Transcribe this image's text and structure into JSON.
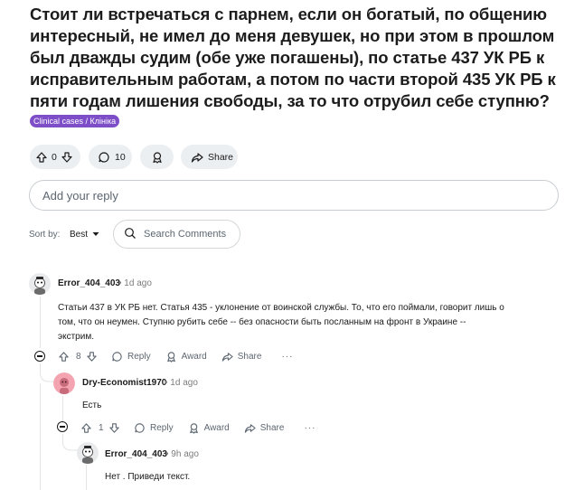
{
  "post": {
    "title": "Стоит ли встречаться с парнем, если он богатый, по общению интересный, не имел до меня девушек, но при этом в прошлом был дважды судим (обе уже погашены), по статье 437 УК РБ к исправительным работам, а потом по части второй 435 УК РБ к пяти годам лишения свободы, за то что отрубил себе ступню?",
    "flair": "Clinical cases / Клініка",
    "vote_count": "0",
    "comment_count": "10",
    "share_label": "Share"
  },
  "reply_box": {
    "placeholder": "Add your reply"
  },
  "sort": {
    "label": "Sort by:",
    "value": "Best"
  },
  "search": {
    "placeholder": "Search Comments"
  },
  "comments": [
    {
      "username": "Error_404_403",
      "time": "1d ago",
      "body_lines": [
        "Статьи 437 в УК РБ нет. Статья 435 - уклонение от воинской службы. То, что его поймали, говорит лишь о",
        "том, что он неумен. Ступню рубить себе -- без опасности быть посланным на фронт в Украине --",
        "экстрим."
      ],
      "votes": "8",
      "reply_label": "Reply",
      "award_label": "Award",
      "share_label": "Share",
      "more_label": "···"
    },
    {
      "username": "Dry-Economist1970",
      "time": "1d ago",
      "body_lines": [
        "Есть"
      ],
      "votes": "1",
      "reply_label": "Reply",
      "award_label": "Award",
      "share_label": "Share",
      "more_label": "···"
    },
    {
      "username": "Error_404_403",
      "time": "9h ago",
      "body_lines": [
        "Нет . Приведи текст."
      ]
    }
  ],
  "colors": {
    "flair_bg": "#7e4ec9",
    "pill_bg": "#eceff1",
    "avatar_pink": "#f4a4b0"
  },
  "separator": "•"
}
